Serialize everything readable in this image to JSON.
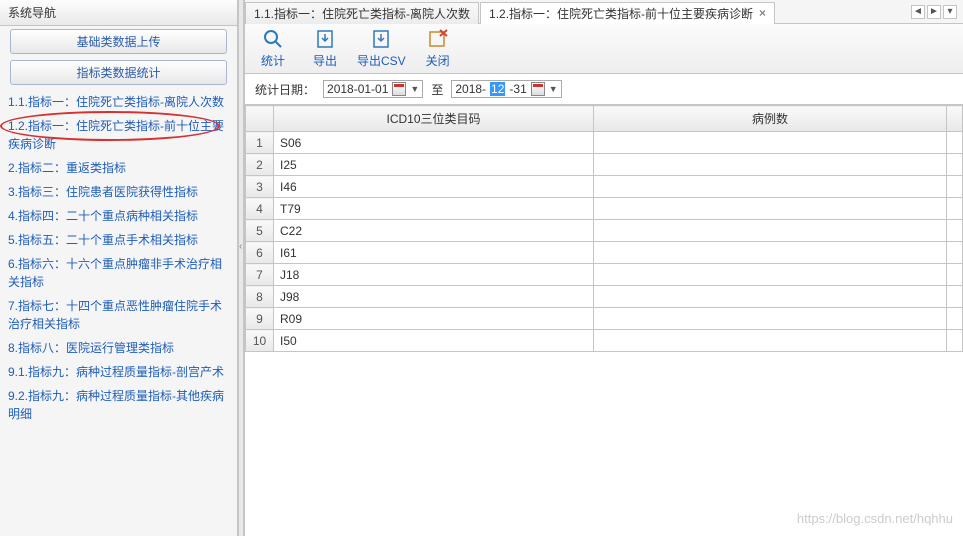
{
  "sidebar": {
    "title": "系统导航",
    "sections": [
      {
        "label": "基础类数据上传"
      },
      {
        "label": "指标类数据统计"
      }
    ],
    "items": [
      {
        "label": "1.1.指标一：住院死亡类指标-离院人次数"
      },
      {
        "label": "1.2.指标一：住院死亡类指标-前十位主要疾病诊断",
        "highlighted": true
      },
      {
        "label": "2.指标二：重返类指标"
      },
      {
        "label": "3.指标三：住院患者医院获得性指标"
      },
      {
        "label": "4.指标四：二十个重点病种相关指标"
      },
      {
        "label": "5.指标五：二十个重点手术相关指标"
      },
      {
        "label": "6.指标六：十六个重点肿瘤非手术治疗相关指标"
      },
      {
        "label": "7.指标七：十四个重点恶性肿瘤住院手术治疗相关指标"
      },
      {
        "label": "8.指标八：医院运行管理类指标"
      },
      {
        "label": "9.1.指标九：病种过程质量指标-剖宫产术"
      },
      {
        "label": "9.2.指标九：病种过程质量指标-其他疾病明细"
      }
    ]
  },
  "tabs": [
    {
      "label": "1.1.指标一：住院死亡类指标-离院人次数",
      "active": false
    },
    {
      "label": "1.2.指标一：住院死亡类指标-前十位主要疾病诊断",
      "active": true
    }
  ],
  "toolbar": {
    "stats": "统计",
    "export": "导出",
    "exportcsv": "导出CSV",
    "close": "关闭"
  },
  "filter": {
    "label": "统计日期：",
    "from": "2018-01-01",
    "to_label": "至",
    "to_prefix": "2018-",
    "to_sel": "12",
    "to_suffix": "-31"
  },
  "table": {
    "col1": "ICD10三位类目码",
    "col2": "病例数",
    "rows": [
      {
        "n": "1",
        "icd": "S06"
      },
      {
        "n": "2",
        "icd": "I25"
      },
      {
        "n": "3",
        "icd": "I46"
      },
      {
        "n": "4",
        "icd": "T79"
      },
      {
        "n": "5",
        "icd": "C22"
      },
      {
        "n": "6",
        "icd": "I61"
      },
      {
        "n": "7",
        "icd": "J18"
      },
      {
        "n": "8",
        "icd": "J98"
      },
      {
        "n": "9",
        "icd": "R09"
      },
      {
        "n": "10",
        "icd": "I50"
      }
    ]
  },
  "watermark": "https://blog.csdn.net/hqhhu"
}
